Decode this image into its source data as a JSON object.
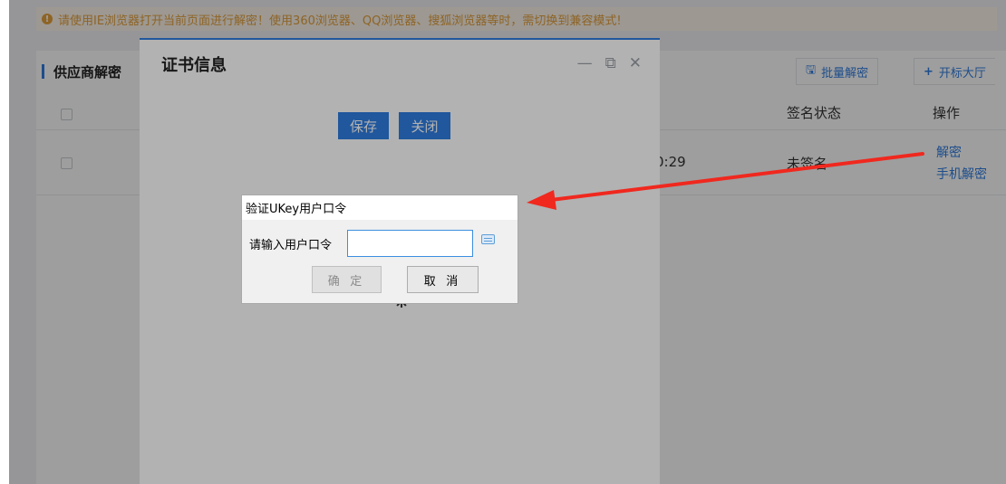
{
  "warning": {
    "text": "请使用IE浏览器打开当前页面进行解密！使用360浏览器、QQ浏览器、搜狐浏览器等时，需切换到兼容模式!",
    "icon": "exclamation-circle-icon",
    "color": "#e6a23c"
  },
  "section": {
    "title": "供应商解密"
  },
  "toolbar": {
    "batch_decrypt_label": "批量解密",
    "batch_decrypt_icon": "save-icon",
    "open_hall_label": "开标大厅",
    "open_hall_icon": "plus-icon"
  },
  "table": {
    "headers": {
      "sign_status": "签名状态",
      "actions": "操作"
    },
    "rows": [
      {
        "time_fragment": "0:29",
        "sign_status": "未签名",
        "actions": [
          "解密",
          "手机解密"
        ]
      }
    ]
  },
  "cert_dialog": {
    "title": "证书信息",
    "save_label": "保存",
    "close_label": "关闭",
    "controls": [
      "minimize-icon",
      "maximize-icon",
      "close-icon"
    ]
  },
  "ukey_dialog": {
    "title": "验证UKey用户口令",
    "prompt_label": "请输入用户口令",
    "password_value": "",
    "ok_label": "确 定",
    "cancel_label": "取 消",
    "keyboard_icon": "soft-keyboard-icon"
  },
  "colors": {
    "accent": "#2f7de1",
    "annotation_arrow": "#f0281e"
  }
}
